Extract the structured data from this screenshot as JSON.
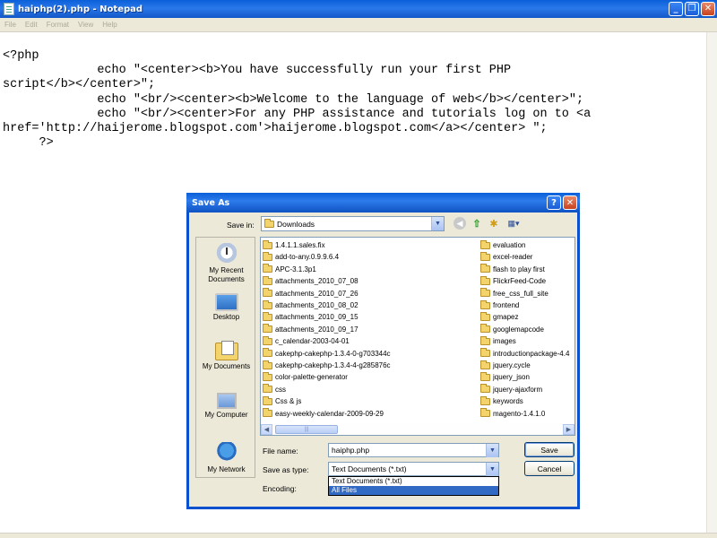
{
  "window": {
    "title": "haiphp(2).php - Notepad",
    "menu": [
      "File",
      "Edit",
      "Format",
      "View",
      "Help"
    ]
  },
  "editor": {
    "lines": [
      "<?php",
      "",
      "             echo \"<center><b>You have successfully run your first PHP",
      "script</b></center>\";",
      "             echo \"<br/><center><b>Welcome to the language of web</b></center>\";",
      "             echo \"<br/><center>For any PHP assistance and tutorials log on to <a",
      "href='http://haijerome.blogspot.com'>haijerome.blogspot.com</a></center> \";",
      "",
      "     ?>"
    ]
  },
  "dialog": {
    "title": "Save As",
    "save_in_label": "Save in:",
    "save_in_value": "Downloads",
    "places": [
      "My Recent Documents",
      "Desktop",
      "My Documents",
      "My Computer",
      "My Network"
    ],
    "files_col1": [
      "1.4.1.1.sales.fix",
      "add-to-any.0.9.9.6.4",
      "APC-3.1.3p1",
      "attachments_2010_07_08",
      "attachments_2010_07_26",
      "attachments_2010_08_02",
      "attachments_2010_09_15",
      "attachments_2010_09_17",
      "c_calendar-2003-04-01",
      "cakephp-cakephp-1.3.4-0-g703344c",
      "cakephp-cakephp-1.3.4-4-g285876c",
      "color-palette-generator",
      "css",
      "Css & js",
      "easy-weekly-calendar-2009-09-29"
    ],
    "files_col2": [
      "evaluation",
      "excel-reader",
      "flash to play first",
      "FlickrFeed-Code",
      "free_css_full_site",
      "frontend",
      "gmapez",
      "googlemapcode",
      "images",
      "introductionpackage-4.4",
      "jquery.cycle",
      "jquery_json",
      "jquery-ajaxform",
      "keywords",
      "magento-1.4.1.0"
    ],
    "file_name_label": "File name:",
    "file_name_value": "haiphp.php",
    "save_type_label": "Save as type:",
    "save_type_value": "Text Documents (*.txt)",
    "encoding_label": "Encoding:",
    "type_options": [
      "Text Documents (*.txt)",
      "All Files"
    ],
    "save_button": "Save",
    "cancel_button": "Cancel"
  },
  "colors": {
    "titlebar": "#0a5fd8",
    "dialog_face": "#ece9d8",
    "selection": "#316ac5"
  }
}
